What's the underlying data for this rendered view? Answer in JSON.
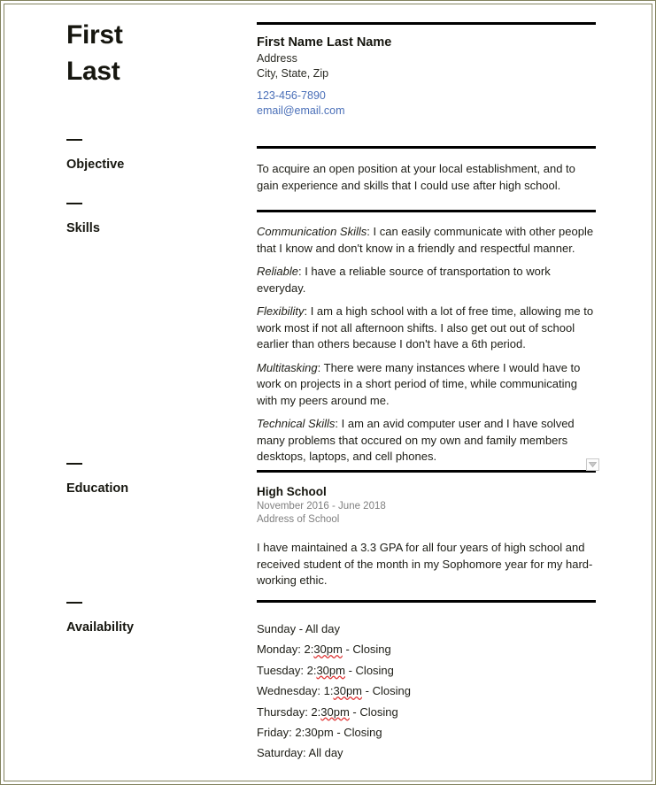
{
  "document": {
    "type": "resume",
    "name_heading": [
      "First",
      "Last"
    ],
    "accent_link_color": "#4a6fb8",
    "rule_color": "#000000",
    "border_color": "#82825e"
  },
  "header": {
    "full_name": "First Name Last Name",
    "address": "Address",
    "city_state_zip": "City, State, Zip",
    "phone": "123-456-7890",
    "email": "email@email.com"
  },
  "sections": {
    "objective": {
      "label": "Objective",
      "text": "To acquire an open position at your local establishment, and to gain experience and skills that I could use after high school."
    },
    "skills": {
      "label": "Skills",
      "items": [
        {
          "term": "Communication Skills",
          "description": ": I can easily communicate with other people that I know and don't know in a friendly and respectful manner."
        },
        {
          "term": "Reliable",
          "description": ": I have a reliable source of transportation to work everyday."
        },
        {
          "term": "Flexibility",
          "description": ": I am a high school with a lot of free time, allowing me to work most if not all afternoon shifts. I also get out out of school earlier than others because I don't have a 6th period."
        },
        {
          "term": "Multitasking",
          "description": ": There were many instances where I would have to work on projects in a short period of time, while communicating with my peers around me."
        },
        {
          "term": "Technical Skills",
          "description": ": I am an avid computer user and I have solved many problems that occured on my own and family members desktops, laptops, and cell phones."
        }
      ]
    },
    "education": {
      "label": "Education",
      "school": "High School",
      "dates": "November 2016  - June 2018",
      "address": "Address of School",
      "description": "I have maintained a 3.3 GPA for all four years of high school and received student of the month in my Sophomore year for my hard-working ethic."
    },
    "availability": {
      "label": "Availability",
      "entries": [
        {
          "before": "Sunday - All day",
          "misspelled": "",
          "after": ""
        },
        {
          "before": "Monday: 2:",
          "misspelled": "30pm",
          "after": " - Closing"
        },
        {
          "before": "Tuesday: 2:",
          "misspelled": "30pm",
          "after": " - Closing"
        },
        {
          "before": "Wednesday: 1:",
          "misspelled": "30pm",
          "after": " - Closing"
        },
        {
          "before": "Thursday: 2:",
          "misspelled": "30pm",
          "after": " - Closing"
        },
        {
          "before": "Friday: 2:30pm - Closing",
          "misspelled": "",
          "after": ""
        },
        {
          "before": "Saturday: All day",
          "misspelled": "",
          "after": ""
        }
      ]
    }
  },
  "controls": {
    "dropdown_icon": "chevron-down-icon"
  }
}
